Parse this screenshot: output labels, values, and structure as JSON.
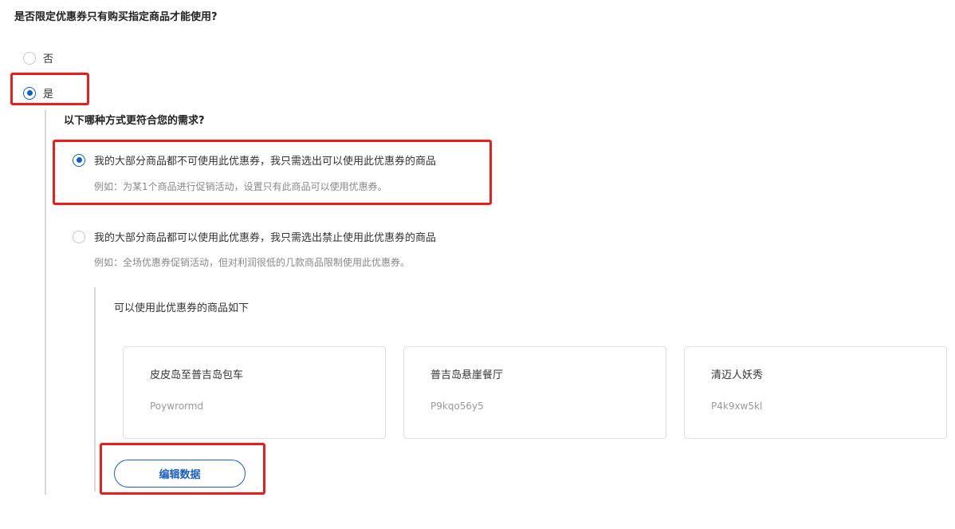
{
  "question": "是否限定优惠券只有购买指定商品才能使用?",
  "option_no": "否",
  "option_yes": "是",
  "sub_question": "以下哪种方式更符合您的需求?",
  "mode_include": {
    "label": "我的大部分商品都不可使用此优惠券，我只需选出可以使用此优惠券的商品",
    "example": "例如：为某1个商品进行促销活动，设置只有此商品可以使用优惠券。",
    "selected": true
  },
  "mode_exclude": {
    "label": "我的大部分商品都可以使用此优惠券，我只需选出禁止使用此优惠券的商品",
    "example": "例如：全场优惠券促销活动，但对利润很低的几款商品限制使用此优惠券。",
    "selected": false
  },
  "products_title": "可以使用此优惠券的商品如下",
  "products": [
    {
      "name": "皮皮岛至普吉岛包车",
      "code": "Poywrormd"
    },
    {
      "name": "普吉岛悬崖餐厅",
      "code": "P9kqo56y5"
    },
    {
      "name": "清迈人妖秀",
      "code": "P4k9xw5kl"
    }
  ],
  "edit_button": "编辑数据",
  "colors": {
    "accent": "#0b61c8",
    "highlight": "#ee1d1d"
  }
}
